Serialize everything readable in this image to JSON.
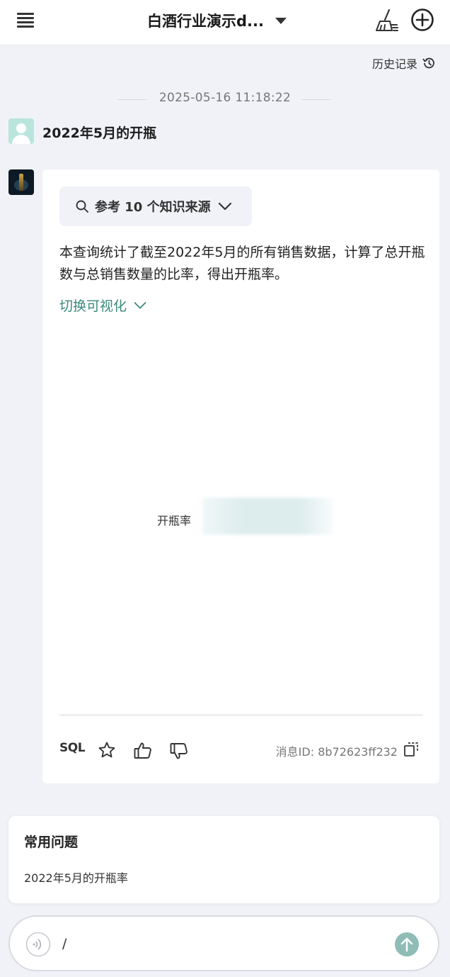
{
  "header": {
    "title": "白酒行业演示d...",
    "icons": [
      "menu-icon",
      "chevron-down-icon",
      "broom-icon",
      "plus-circle-icon"
    ]
  },
  "history": {
    "label": "历史记录",
    "icon": "history-icon"
  },
  "timestamp": "2025-05-16 11:18:22",
  "user_message": "2022年5月的开瓶",
  "bot_message": {
    "sources_label": "参考 10 个知识来源",
    "answer": "本查询统计了截至2022年5月的所有销售数据，计算了总开瓶数与总销售数量的比率，得出开瓶率。",
    "viz_toggle_label": "切换可视化",
    "chart": {
      "label": "开瓶率",
      "bar_color": "#dcebec"
    },
    "actions": {
      "sql_label": "SQL",
      "icons": [
        "star-icon",
        "thumbs-up-icon",
        "thumbs-down-icon",
        "copy-icon"
      ]
    },
    "message_id": "消息ID: 8b72623ff232"
  },
  "faq": {
    "title": "常用问题",
    "items": [
      "2022年5月的开瓶率"
    ]
  },
  "composer": {
    "value": "/",
    "send_color": "#8fbdb6"
  },
  "colors": {
    "accent": "#3a8a7e",
    "background": "#f0f2f7"
  }
}
